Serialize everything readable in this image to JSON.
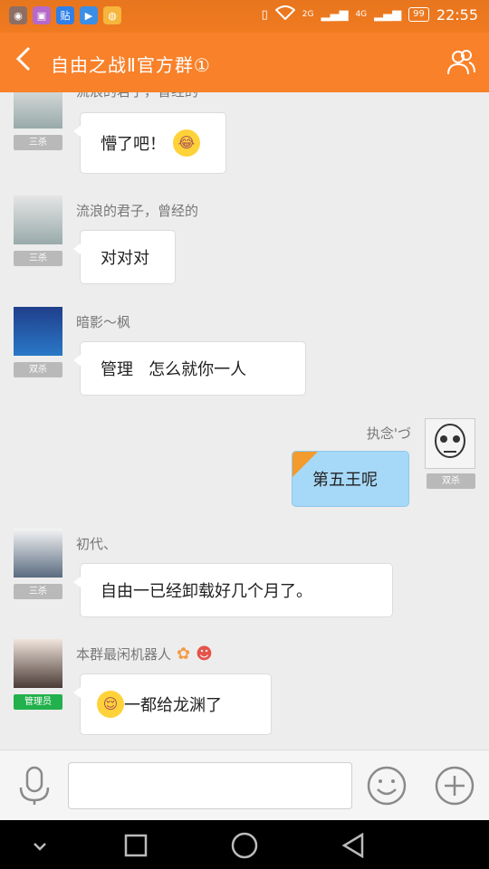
{
  "status_bar": {
    "apps": [
      {
        "icon": "photo-app-icon",
        "color": "#8d6e63",
        "glyph": "◉"
      },
      {
        "icon": "gallery-app-icon",
        "color": "#b569c9",
        "glyph": "▣"
      },
      {
        "icon": "tieba-app-icon",
        "color": "#2f7fe8",
        "glyph": "贴"
      },
      {
        "icon": "video-app-icon",
        "color": "#3a8ee6",
        "glyph": "▶"
      },
      {
        "icon": "camera-app-icon",
        "color": "#f6b53c",
        "glyph": "◍"
      }
    ],
    "network_2g": "2G",
    "network_4g": "4G",
    "battery": "99",
    "time": "22:55"
  },
  "header": {
    "title": "自由之战Ⅱ官方群①",
    "back_icon": "back-arrow-icon",
    "members_icon": "group-members-icon"
  },
  "messages": [
    {
      "sender": "流浪的君子，曾经的",
      "tag": "三杀",
      "text": "懵了吧！",
      "emoji": "😂",
      "mine": false
    },
    {
      "sender": "流浪的君子，曾经的",
      "tag": "三杀",
      "text": "对对对",
      "mine": false
    },
    {
      "sender": "暗影～枫",
      "tag": "双杀",
      "text": "管理   怎么就你一人",
      "mine": false
    },
    {
      "sender": "执念'づ",
      "tag": "双杀",
      "text": "第五王呢",
      "mine": true
    },
    {
      "sender": "初代、",
      "tag": "三杀",
      "text": "自由一已经卸载好几个月了。",
      "mine": false
    },
    {
      "sender": "本群最闲机器人",
      "tag": "管理员",
      "text": "一都给龙渊了",
      "emoji": "😌",
      "mine": false
    }
  ],
  "input_bar": {
    "voice_icon": "microphone-icon",
    "placeholder": "",
    "emoji_icon": "smiley-icon",
    "more_icon": "plus-icon"
  },
  "nav_bar": {
    "icons": [
      "chevron-down-icon",
      "recent-apps-icon",
      "home-icon",
      "back-triangle-icon"
    ]
  },
  "colors": {
    "accent": "#f8812a",
    "my_bubble": "#a6d8f7",
    "admin_tag": "#22b14c"
  }
}
